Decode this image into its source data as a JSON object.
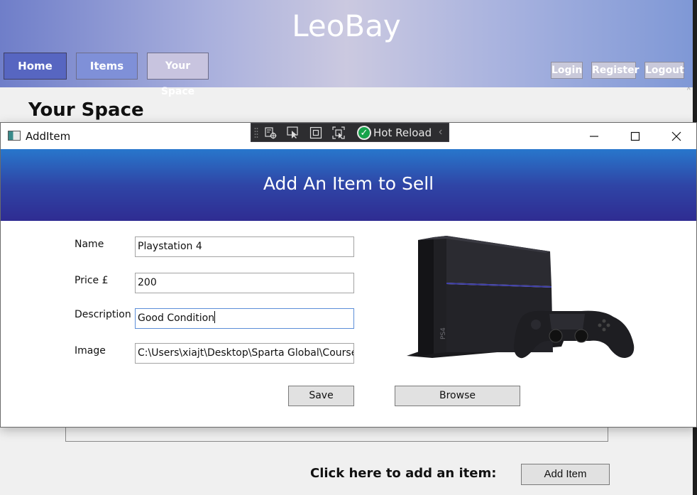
{
  "app": {
    "title": "LeoBay",
    "nav": {
      "home": "Home",
      "items": "Items",
      "your_space": "Your Space"
    },
    "auth": {
      "login": "Login",
      "register": "Register",
      "logout": "Logout"
    },
    "page_heading": "Your Space",
    "add_prompt": "Click here to add an item:",
    "add_item_button": "Add Item"
  },
  "dialog": {
    "window_title": "AddItem",
    "toolbar": {
      "hot_reload": "Hot Reload"
    },
    "heading": "Add An Item to Sell",
    "fields": {
      "name_label": "Name",
      "name_value": "Playstation 4",
      "price_label": "Price £",
      "price_value": "200",
      "description_label": "Description",
      "description_value": "Good Condition",
      "image_label": "Image",
      "image_value": "C:\\Users\\xiajt\\Desktop\\Sparta Global\\Course\\P"
    },
    "save_button": "Save",
    "browse_button": "Browse"
  },
  "colors": {
    "banner_top": "#2877cc",
    "banner_bottom": "#2f2c92",
    "nav_home": "#5766c1",
    "nav_items": "#7f90d8"
  }
}
